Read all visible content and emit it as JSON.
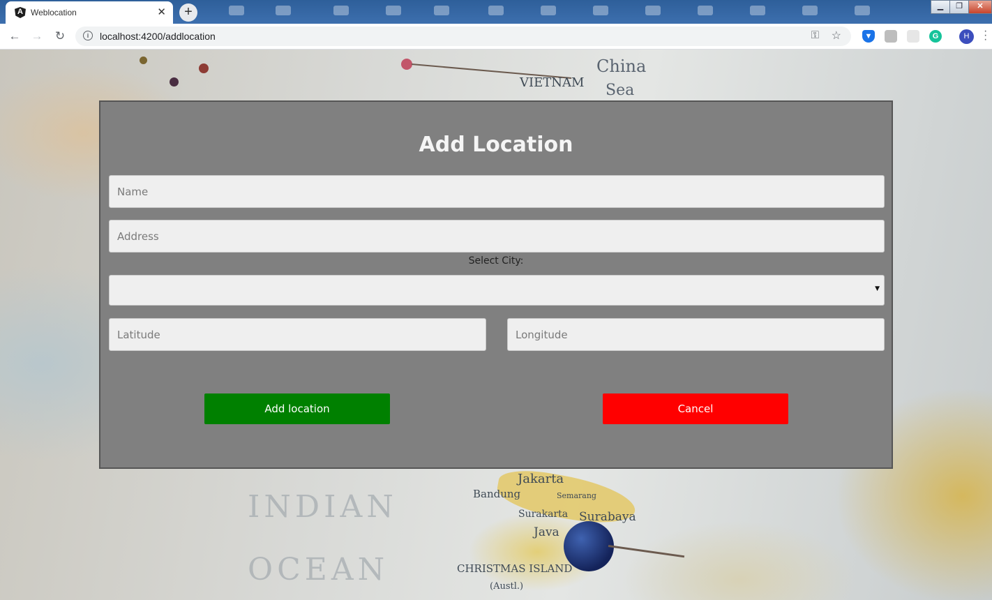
{
  "browser": {
    "tab_title": "Weblocation",
    "tab_close": "✕",
    "new_tab": "+",
    "url": "localhost:4200/addlocation",
    "avatar_initial": "H",
    "favicon_letter": "A"
  },
  "background": {
    "labels": {
      "vietnam": "VIETNAM",
      "china": "China",
      "sea": "Sea",
      "jakarta": "Jakarta",
      "bandung": "Bandung",
      "semarang": "Semarang",
      "surakarta": "Surakarta",
      "surabaya": "Surabaya",
      "java": "Java",
      "christmas_island": "CHRISTMAS ISLAND",
      "austl": "(Austl.)",
      "indian": "INDIAN",
      "ocean": "OCEAN"
    }
  },
  "form": {
    "title": "Add Location",
    "name_placeholder": "Name",
    "address_placeholder": "Address",
    "city_label": "Select City:",
    "city_selected": "",
    "latitude_placeholder": "Latitude",
    "longitude_placeholder": "Longitude",
    "add_button": "Add location",
    "cancel_button": "Cancel"
  },
  "colors": {
    "panel": "#808080",
    "add_button": "#008000",
    "cancel_button": "#ff0000"
  }
}
